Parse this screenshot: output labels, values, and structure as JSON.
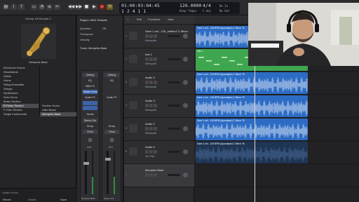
{
  "toolbar": {
    "position": "01:00:03:04:45",
    "bars": "1 2 4 1 1",
    "tempo": "126.0000",
    "tempo_label": "Keep Tempo",
    "signature": "4/4",
    "key": "C maj",
    "in_label": "No In",
    "out_label": "No Out",
    "small_left": "BAR  BEAT  DIV  TICK",
    "small_mid": "TEMPO"
  },
  "library": {
    "header": "Library: All Sounds C",
    "patch_title": "Memphis Blast",
    "categories": [
      "Electronic Drums",
      "Woodwinds",
      "Guitar",
      "Horns",
      "String Ensemble",
      "Strings",
      "Synthesizer",
      "Solo Horns",
      "Brass Section",
      "B-Piano Section",
      "F-Horn Section",
      "Single Instruments"
    ],
    "subcategories": [
      "Section Horns",
      "Little Brass",
      "Memphis Blast"
    ],
    "bottom_left": "Studio Horns",
    "bottom_revert": "Revert",
    "bottom_delete": "Delete",
    "bottom_save": "Save"
  },
  "inspector": {
    "region": "Region: MIDI Defaults",
    "quantize": "Quantize",
    "qvalue": "Off",
    "transpose": "Transpose",
    "velocity": "Velocity",
    "track": "Track: Memphis Blast",
    "setting": "Setting",
    "eq": "EQ",
    "midi_fx": "MIDI FX",
    "instrument": "Studio Horns",
    "audio_fx": "Audio FX",
    "sends": "Sends",
    "stereo_out": "Stereo Out",
    "group": "Group",
    "read": "Read",
    "vol_left": "-4.6",
    "vol_right": "0.0",
    "name_left": "Memphis Blast",
    "name_right": "Stereo Out"
  },
  "tracks_header": {
    "edit": "Edit",
    "functions": "Functions",
    "view": "View"
  },
  "tracks": [
    {
      "num": "1",
      "name": "Save 1.m4 - 126_melkor2 C Minor",
      "sub": "Metropolis"
    },
    {
      "num": "2",
      "name": "Inst 1",
      "sub": "Metropolis"
    },
    {
      "num": "3",
      "name": "Audio 3",
      "sub": "Metropolis"
    },
    {
      "num": "4",
      "name": "Audio 3",
      "sub": "Metropolis"
    },
    {
      "num": "5",
      "name": "Audio 4",
      "sub": "Metropolis"
    },
    {
      "num": "6",
      "name": "Audio 5",
      "sub": "Vox Pad"
    },
    {
      "num": "7",
      "name": "Memphis Blast",
      "sub": ""
    }
  ],
  "regions": [
    {
      "label": "Save 1.m4 - 126 BPM (Apocalyse) C Minor 76",
      "kind": "audio"
    },
    {
      "label": "Inst 1",
      "kind": "midi"
    },
    {
      "label": "Save 1.m4 - 126 BPM (Apocalyse) C Minor 76",
      "kind": "audio"
    },
    {
      "label": "Save 1.m4 - 126 BPM (Apocalyse) C Minor 76",
      "kind": "audio"
    },
    {
      "label": "Save 1.m4 - 126 BPM (Apocalyse) C Minor 76",
      "kind": "audio"
    },
    {
      "label": "Save 1.m4 - 126 BPM (Apocalyse) C Minor 76",
      "kind": "dark"
    }
  ],
  "colors": {
    "audio_region": "#2d6cc4",
    "midi_region": "#3fa650",
    "selected_slot": "#3e63a8"
  }
}
